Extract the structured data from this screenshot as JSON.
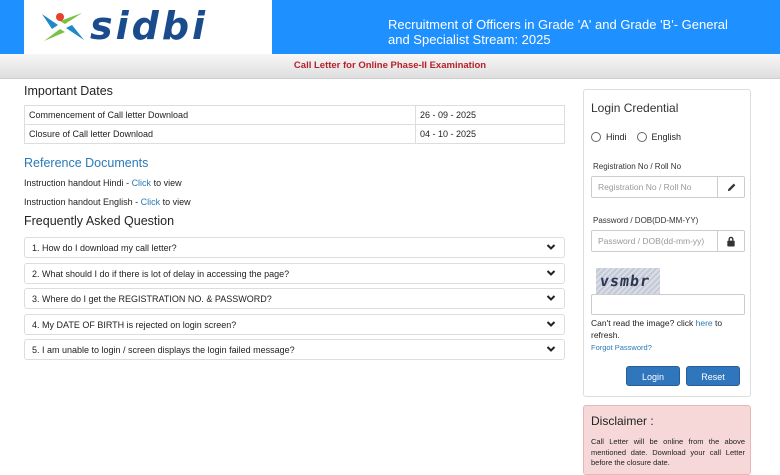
{
  "header": {
    "logo_text": "sidbi",
    "title": "Recruitment of Officers in Grade 'A' and Grade 'B'- General and Specialist Stream: 2025"
  },
  "subbar": {
    "text": "Call Letter for Online Phase-II Examination"
  },
  "important_dates": {
    "title": "Important Dates",
    "rows": [
      {
        "label": "Commencement of Call letter Download",
        "value": "26 - 09 - 2025"
      },
      {
        "label": "Closure of Call letter Download",
        "value": "04 - 10 - 2025"
      }
    ]
  },
  "reference": {
    "title": "Reference Documents",
    "items": [
      {
        "prefix": "Instruction handout Hindi - ",
        "link": "Click",
        "suffix": " to view"
      },
      {
        "prefix": "Instruction handout English - ",
        "link": "Click",
        "suffix": " to view"
      }
    ]
  },
  "faq": {
    "title": "Frequently Asked Question",
    "items": [
      "1. How do I download my call letter?",
      "2. What should I do if there is lot of delay in accessing the page?",
      "3. Where do I get the REGISTRATION NO. & PASSWORD?",
      "4. My DATE OF BIRTH is rejected on login screen?",
      "5. I am unable to login / screen displays the login failed message?"
    ]
  },
  "login": {
    "title": "Login Credential",
    "lang_hindi": "Hindi",
    "lang_english": "English",
    "reg_label": "Registration No / Roll No",
    "reg_placeholder": "Registration No / Roll No",
    "pwd_label": "Password / DOB(DD-MM-YY)",
    "pwd_placeholder": "Password / DOB(dd-mm-yy)",
    "captcha_text": "vsmbr",
    "cant_read_prefix": "Can't read the image? click ",
    "cant_read_link": "here",
    "cant_read_suffix": " to refresh.",
    "forgot": "Forgot Password?",
    "login_btn": "Login",
    "reset_btn": "Reset"
  },
  "disclaimer": {
    "title": "Disclaimer :",
    "body": "Call Letter will be online from the above mentioned date. Download your call Letter before the closure date."
  },
  "colors": {
    "header_blue": "#1e90ff",
    "link_blue": "#2a7ab8",
    "subbar_red": "#b8202a",
    "button_blue": "#2f76bd"
  },
  "icons": [
    "sidbi-logo-icon",
    "chevron-down-icon",
    "pencil-icon",
    "lock-icon"
  ]
}
